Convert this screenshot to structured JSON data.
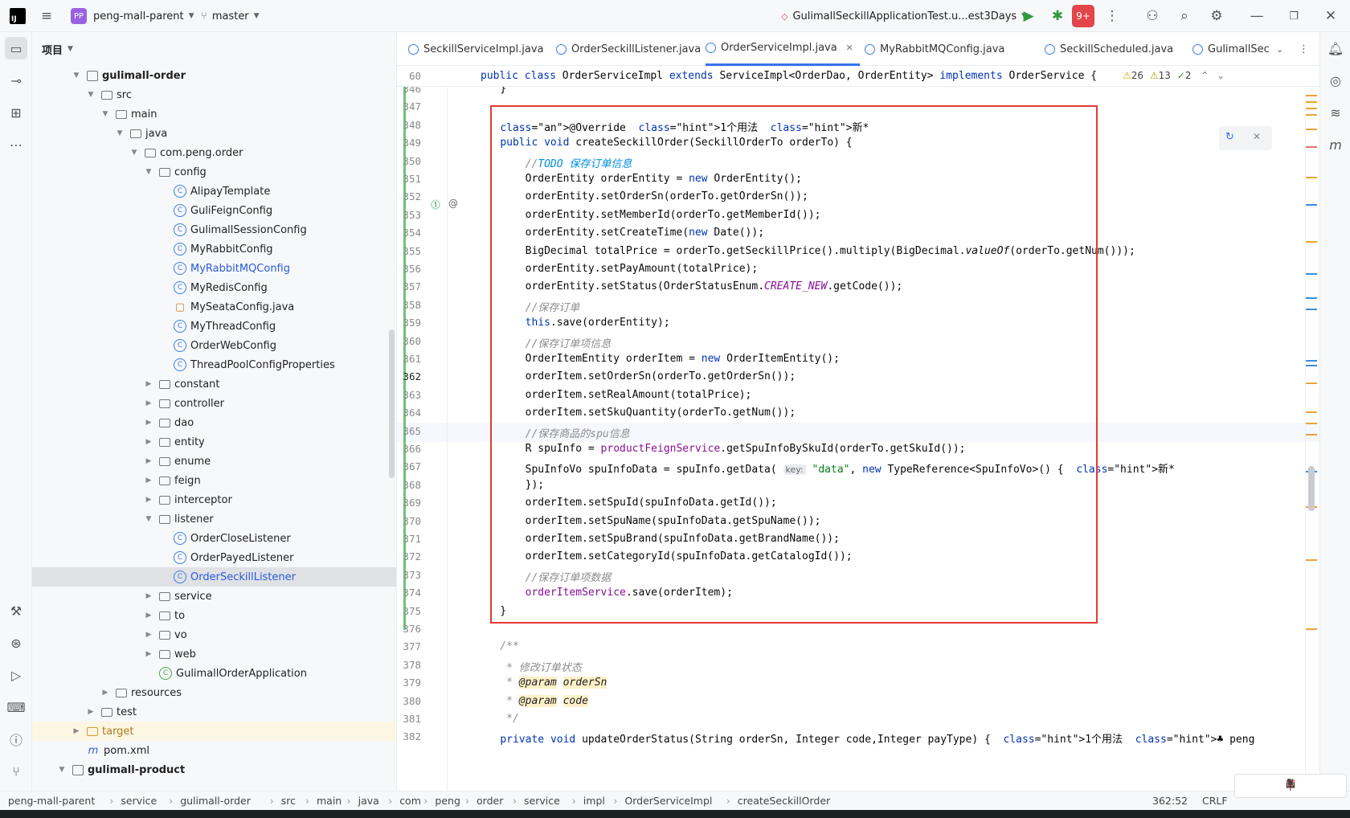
{
  "titlebar": {
    "project_name": "peng-mall-parent",
    "project_badge": "PP",
    "branch": "master",
    "run_config": "GulimallSeckillApplicationTest.u...est3Days",
    "notification_count": "9+"
  },
  "project_panel": {
    "title": "项目",
    "tree": [
      {
        "label": "gulimall-order",
        "depth": 2,
        "icon": "module",
        "expanded": true,
        "bold": true
      },
      {
        "label": "src",
        "depth": 3,
        "icon": "folder",
        "expanded": true
      },
      {
        "label": "main",
        "depth": 4,
        "icon": "folder",
        "expanded": true
      },
      {
        "label": "java",
        "depth": 5,
        "icon": "folder",
        "expanded": true
      },
      {
        "label": "com.peng.order",
        "depth": 6,
        "icon": "package",
        "expanded": true
      },
      {
        "label": "config",
        "depth": 7,
        "icon": "package",
        "expanded": true
      },
      {
        "label": "AlipayTemplate",
        "depth": 8,
        "icon": "class"
      },
      {
        "label": "GuliFeignConfig",
        "depth": 8,
        "icon": "class"
      },
      {
        "label": "GulimallSessionConfig",
        "depth": 8,
        "icon": "class"
      },
      {
        "label": "MyRabbitConfig",
        "depth": 8,
        "icon": "class"
      },
      {
        "label": "MyRabbitMQConfig",
        "depth": 8,
        "icon": "class",
        "blue": true
      },
      {
        "label": "MyRedisConfig",
        "depth": 8,
        "icon": "class"
      },
      {
        "label": "MySeataConfig.java",
        "depth": 8,
        "icon": "javafile"
      },
      {
        "label": "MyThreadConfig",
        "depth": 8,
        "icon": "class"
      },
      {
        "label": "OrderWebConfig",
        "depth": 8,
        "icon": "class"
      },
      {
        "label": "ThreadPoolConfigProperties",
        "depth": 8,
        "icon": "class"
      },
      {
        "label": "constant",
        "depth": 7,
        "icon": "package",
        "expanded": false
      },
      {
        "label": "controller",
        "depth": 7,
        "icon": "package",
        "expanded": false
      },
      {
        "label": "dao",
        "depth": 7,
        "icon": "package",
        "expanded": false
      },
      {
        "label": "entity",
        "depth": 7,
        "icon": "package",
        "expanded": false
      },
      {
        "label": "enume",
        "depth": 7,
        "icon": "package",
        "expanded": false
      },
      {
        "label": "feign",
        "depth": 7,
        "icon": "package",
        "expanded": false
      },
      {
        "label": "interceptor",
        "depth": 7,
        "icon": "package",
        "expanded": false
      },
      {
        "label": "listener",
        "depth": 7,
        "icon": "package",
        "expanded": true
      },
      {
        "label": "OrderCloseListener",
        "depth": 8,
        "icon": "class"
      },
      {
        "label": "OrderPayedListener",
        "depth": 8,
        "icon": "class"
      },
      {
        "label": "OrderSeckillListener",
        "depth": 8,
        "icon": "class",
        "selected": true,
        "blue": true
      },
      {
        "label": "service",
        "depth": 7,
        "icon": "package",
        "expanded": false
      },
      {
        "label": "to",
        "depth": 7,
        "icon": "package",
        "expanded": false
      },
      {
        "label": "vo",
        "depth": 7,
        "icon": "package",
        "expanded": false
      },
      {
        "label": "web",
        "depth": 7,
        "icon": "package",
        "expanded": false
      },
      {
        "label": "GulimallOrderApplication",
        "depth": 7,
        "icon": "springclass"
      },
      {
        "label": "resources",
        "depth": 4,
        "icon": "folder",
        "expanded": false
      },
      {
        "label": "test",
        "depth": 3,
        "icon": "folder",
        "expanded": false
      },
      {
        "label": "target",
        "depth": 2,
        "icon": "folder-orange",
        "expanded": false,
        "highlight": true
      },
      {
        "label": "pom.xml",
        "depth": 2,
        "icon": "maven"
      },
      {
        "label": "gulimall-product",
        "depth": 1,
        "icon": "module",
        "expanded": true,
        "bold": true
      }
    ]
  },
  "editor": {
    "tabs": [
      {
        "label": "SeckillServiceImpl.java"
      },
      {
        "label": "OrderSeckillListener.java"
      },
      {
        "label": "OrderServiceImpl.java",
        "active": true
      },
      {
        "label": "MyRabbitMQConfig.java"
      },
      {
        "label": "SeckillScheduled.java"
      },
      {
        "label": "GulimallSec"
      }
    ],
    "inspections": {
      "warnings": "26",
      "weak_warnings": "13",
      "ok": "2"
    },
    "sticky": {
      "line": "60",
      "text": "public class OrderServiceImpl extends ServiceImpl<OrderDao, OrderEntity> implements OrderService {"
    },
    "lines": [
      {
        "n": "346",
        "t": "    }"
      },
      {
        "n": "347",
        "t": ""
      },
      {
        "n": "348",
        "t": "    @Override  1个用法  新*"
      },
      {
        "n": "349",
        "t": "    public void createSeckillOrder(SeckillOrderTo orderTo) {"
      },
      {
        "n": "350",
        "t": "        //TODO 保存订单信息"
      },
      {
        "n": "351",
        "t": "        OrderEntity orderEntity = new OrderEntity();"
      },
      {
        "n": "352",
        "t": "        orderEntity.setOrderSn(orderTo.getOrderSn());"
      },
      {
        "n": "353",
        "t": "        orderEntity.setMemberId(orderTo.getMemberId());"
      },
      {
        "n": "354",
        "t": "        orderEntity.setCreateTime(new Date());"
      },
      {
        "n": "355",
        "t": "        BigDecimal totalPrice = orderTo.getSeckillPrice().multiply(BigDecimal.valueOf(orderTo.getNum()));"
      },
      {
        "n": "356",
        "t": "        orderEntity.setPayAmount(totalPrice);"
      },
      {
        "n": "357",
        "t": "        orderEntity.setStatus(OrderStatusEnum.CREATE_NEW.getCode());"
      },
      {
        "n": "358",
        "t": "        //保存订单"
      },
      {
        "n": "359",
        "t": "        this.save(orderEntity);"
      },
      {
        "n": "360",
        "t": "        //保存订单项信息"
      },
      {
        "n": "361",
        "t": "        OrderItemEntity orderItem = new OrderItemEntity();"
      },
      {
        "n": "362",
        "t": "        orderItem.setOrderSn(orderTo.getOrderSn());"
      },
      {
        "n": "363",
        "t": "        orderItem.setRealAmount(totalPrice);"
      },
      {
        "n": "364",
        "t": "        orderItem.setSkuQuantity(orderTo.getNum());"
      },
      {
        "n": "365",
        "t": "        //保存商品的spu信息"
      },
      {
        "n": "366",
        "t": "        R spuInfo = productFeignService.getSpuInfoBySkuId(orderTo.getSkuId());"
      },
      {
        "n": "367",
        "t": "        SpuInfoVo spuInfoData = spuInfo.getData( key: \"data\", new TypeReference<SpuInfoVo>() {  新*"
      },
      {
        "n": "368",
        "t": "        });"
      },
      {
        "n": "369",
        "t": "        orderItem.setSpuId(spuInfoData.getId());"
      },
      {
        "n": "370",
        "t": "        orderItem.setSpuName(spuInfoData.getSpuName());"
      },
      {
        "n": "371",
        "t": "        orderItem.setSpuBrand(spuInfoData.getBrandName());"
      },
      {
        "n": "372",
        "t": "        orderItem.setCategoryId(spuInfoData.getCatalogId());"
      },
      {
        "n": "373",
        "t": "        //保存订单项数据"
      },
      {
        "n": "374",
        "t": "        orderItemService.save(orderItem);"
      },
      {
        "n": "375",
        "t": "    }"
      },
      {
        "n": "376",
        "t": ""
      },
      {
        "n": "377",
        "t": "    /**"
      },
      {
        "n": "378",
        "t": "     * 修改订单状态"
      },
      {
        "n": "379",
        "t": "     * @param orderSn"
      },
      {
        "n": "380",
        "t": "     * @param code"
      },
      {
        "n": "381",
        "t": "     */"
      },
      {
        "n": "382",
        "t": "    private void updateOrderStatus(String orderSn, Integer code,Integer payType) {  1个用法  ♣ peng"
      }
    ]
  },
  "statusbar": {
    "breadcrumbs": [
      "peng-mall-parent",
      "service",
      "gulimall-order",
      "src",
      "main",
      "java",
      "com",
      "peng",
      "order",
      "service",
      "impl",
      "OrderServiceImpl",
      "createSeckillOrder"
    ],
    "position": "362:52",
    "line_sep": "CRLF"
  },
  "colors": {
    "accent": "#3574f0",
    "highlight_rect": "#e53935",
    "keyword": "#0033b3",
    "annotation": "#9e880d",
    "string": "#067d17"
  }
}
